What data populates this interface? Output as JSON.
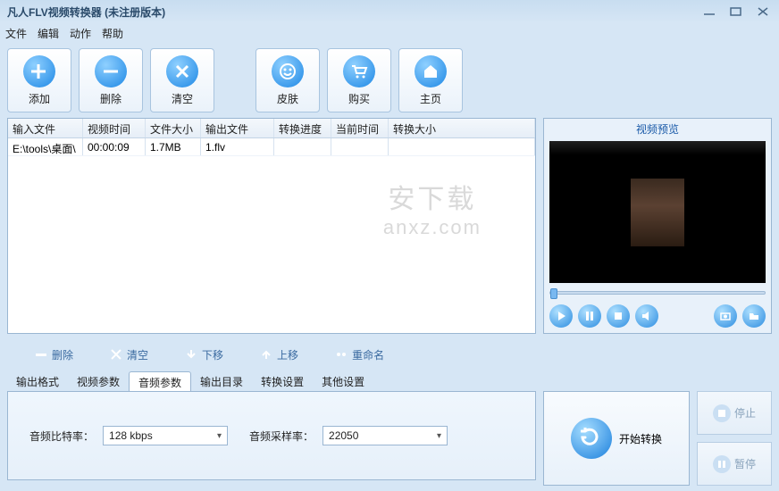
{
  "title": "凡人FLV视频转换器   (未注册版本)",
  "menu": {
    "file": "文件",
    "edit": "编辑",
    "action": "动作",
    "help": "帮助"
  },
  "toolbar": {
    "add": "添加",
    "delete": "删除",
    "clear": "清空",
    "skin": "皮肤",
    "buy": "购买",
    "home": "主页"
  },
  "table": {
    "headers": {
      "input": "输入文件",
      "duration": "视频时间",
      "size": "文件大小",
      "output": "输出文件",
      "progress": "转换进度",
      "curtime": "当前时间",
      "outsize": "转换大小"
    },
    "rows": [
      {
        "input": "E:\\tools\\桌面\\",
        "duration": "00:00:09",
        "size": "1.7MB",
        "output": "1.flv",
        "progress": "",
        "curtime": "",
        "outsize": ""
      }
    ]
  },
  "watermark": {
    "l1": "安下载",
    "l2": "anxz.com"
  },
  "preview": {
    "title": "视频预览"
  },
  "rowactions": {
    "delete": "删除",
    "clear": "清空",
    "down": "下移",
    "up": "上移",
    "rename": "重命名"
  },
  "tabs": {
    "fmt": "输出格式",
    "video": "视频参数",
    "audio": "音频参数",
    "dir": "输出目录",
    "conv": "转换设置",
    "other": "其他设置"
  },
  "audio": {
    "bitrate_label": "音频比特率：",
    "bitrate_value": "128 kbps",
    "samplerate_label": "音频采样率：",
    "samplerate_value": "22050"
  },
  "actions": {
    "start": "开始转换",
    "stop": "停止",
    "pause": "暂停"
  }
}
